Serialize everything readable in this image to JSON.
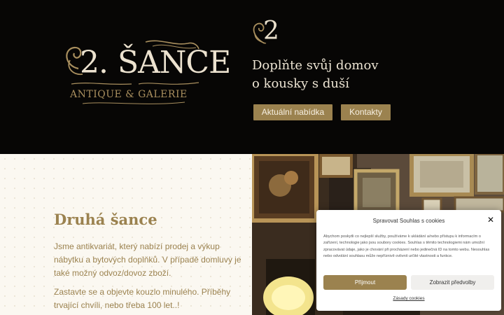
{
  "hero": {
    "logo": {
      "number": "2.",
      "name": "ŠANCE",
      "subtitle": "ANTIQUE & GALERIE"
    },
    "mark_number": "2",
    "tagline_line1": "Doplňte svůj domov",
    "tagline_line2": "o kousky s duší",
    "buttons": {
      "offer": "Aktuální nabídka",
      "contact": "Kontakty"
    }
  },
  "about": {
    "title": "Druhá šance",
    "paragraph1": "Jsme antikvariát, který nabízí prodej a výkup nábytku a bytových doplňků. V případě domluvy je také možný odvoz/dovoz zboží.",
    "paragraph2": "Zastavte se a objevte kouzlo minulého. Příběhy trvající chvíli, nebo třeba 100 let..!"
  },
  "cookie": {
    "title": "Spravovat Souhlas s cookies",
    "close_icon": "close-icon",
    "text": "Abychom poskytli co nejlepší služby, používáme k ukládání a/nebo přístupu k informacím o zařízení, technologie jako jsou soubory cookies. Souhlas s těmito technologiemi nám umožní zpracovávat údaje, jako je chování při procházení nebo jedinečná ID na tomto webu. Nesouhlas nebo odvolání souhlasu může nepříznivě ovlivnit určité vlastnosti a funkce.",
    "accept": "Přijmout",
    "preferences": "Zobrazit předvolby",
    "link": "Zásady cookies"
  },
  "colors": {
    "gold": "#9b824f",
    "dark": "#070605",
    "cream": "#fbf8f1"
  }
}
